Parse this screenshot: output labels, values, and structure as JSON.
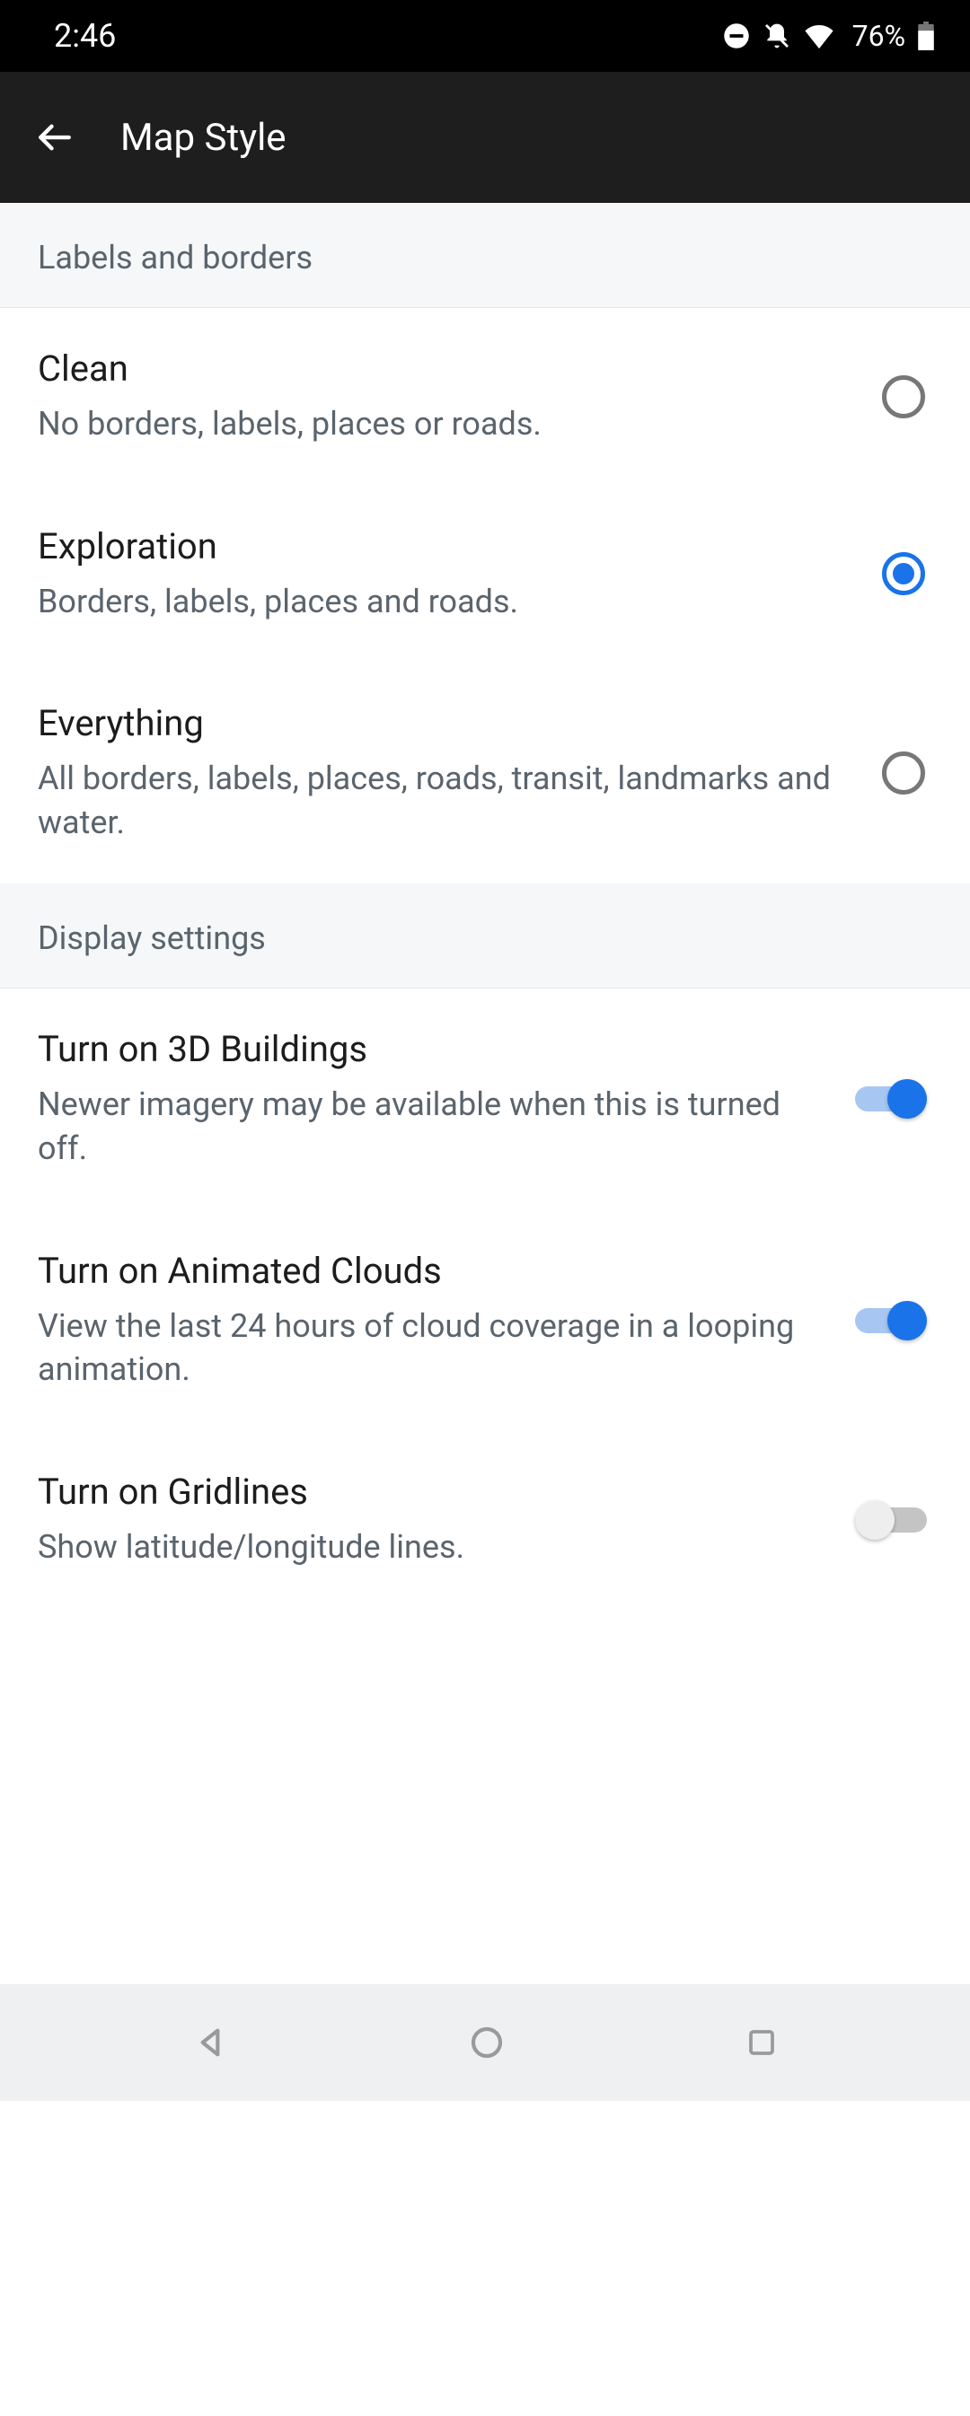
{
  "status": {
    "time": "2:46",
    "battery": "76%"
  },
  "header": {
    "title": "Map Style"
  },
  "sections": {
    "labels": {
      "header": "Labels and borders",
      "options": [
        {
          "title": "Clean",
          "subtitle": "No borders, labels, places or roads.",
          "selected": false
        },
        {
          "title": "Exploration",
          "subtitle": "Borders, labels, places and roads.",
          "selected": true
        },
        {
          "title": "Everything",
          "subtitle": "All borders, labels, places, roads, transit, landmarks and water.",
          "selected": false
        }
      ]
    },
    "display": {
      "header": "Display settings",
      "options": [
        {
          "title": "Turn on 3D Buildings",
          "subtitle": "Newer imagery may be available when this is turned off.",
          "on": true
        },
        {
          "title": "Turn on Animated Clouds",
          "subtitle": "View the last 24 hours of cloud coverage in a looping animation.",
          "on": true
        },
        {
          "title": "Turn on Gridlines",
          "subtitle": "Show latitude/longitude lines.",
          "on": false
        }
      ]
    }
  }
}
